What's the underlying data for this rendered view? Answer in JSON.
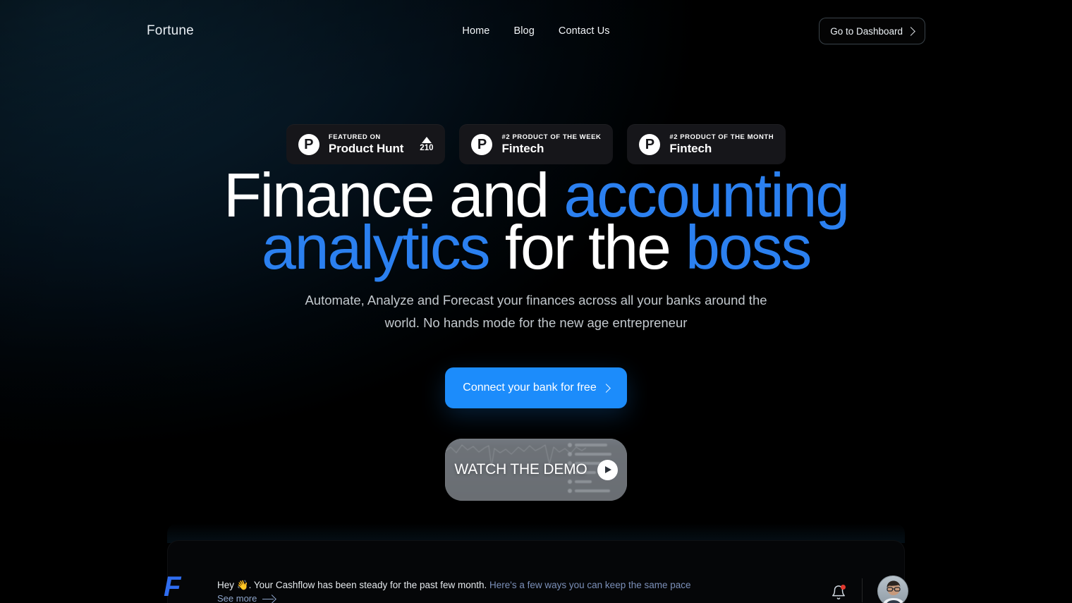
{
  "header": {
    "brand": "Fortune",
    "nav": [
      {
        "label": "Home",
        "name": "nav-home"
      },
      {
        "label": "Blog",
        "name": "nav-blog"
      },
      {
        "label": "Contact Us",
        "name": "nav-contact-us"
      }
    ],
    "dashboard_button": "Go to Dashboard"
  },
  "badges": [
    {
      "logo": "P",
      "kicker": "FEATURED ON",
      "title": "Product Hunt",
      "vote_count": "210",
      "has_vote": true
    },
    {
      "logo": "P",
      "kicker": "#2 PRODUCT OF THE WEEK",
      "title": "Fintech",
      "has_vote": false
    },
    {
      "logo": "P",
      "kicker": "#2 PRODUCT OF THE MONTH",
      "title": "Fintech",
      "has_vote": false
    }
  ],
  "hero": {
    "headline_part1": "Finance and ",
    "headline_accent1": "accounting",
    "headline_accent2": "analytics",
    "headline_part2": " for the ",
    "headline_accent3": "boss",
    "subtitle": "Automate, Analyze and Forecast your finances across all your banks around the world. No hands mode for the new age entrepreneur",
    "cta_label": "Connect your bank for free",
    "demo_label": "WATCH THE DEMO"
  },
  "app_panel": {
    "logo_letter": "F",
    "message_main": "Hey 👋. Your Cashflow has been steady for the past few month. ",
    "message_link": "Here's a few ways you can keep the same pace",
    "see_more": "See more"
  },
  "colors": {
    "accent_blue": "#2b80f0",
    "cta_blue": "#1c8cfb",
    "background_dark": "#01070c",
    "notification_red": "#e2392f",
    "badge_card": "#16161a"
  }
}
